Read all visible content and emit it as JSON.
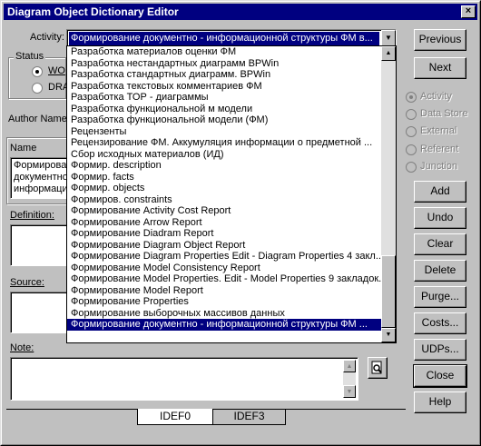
{
  "window": {
    "title": "Diagram Object Dictionary Editor",
    "close_glyph": "×"
  },
  "activity": {
    "label": "Activity:",
    "selected": "Формирование документно -  информационной структуры ФМ в...",
    "dropdown_items": [
      "Разработка материалов оценки ФМ",
      "Разработка нестандартных диаграмм  BPWin",
      "Разработка  стандартных диаграмм.  BPWin",
      "Разработка текстовых комментариев ФМ",
      "Разработка ТОР - диаграммы",
      "Разработка  функциональной м модели",
      "Разработка функциональной модели (ФМ)",
      "Рецензенты",
      "Рецензирование ФМ. Аккумуляция информации о предметной ...",
      "Сбор исходных материалов (ИД)",
      "Формир. description",
      "Формир. facts",
      "Формир. objects",
      "Формиров. constraints",
      "Формирование Activity Cost Report",
      "Формирование Arrow Report",
      "Формирование Diadram Report",
      "Формирование Diagram Object  Report",
      "Формирование Diagram Properties  Edit - Diagram Properties 4 закл...",
      "Формирование Model Consistency Report",
      "Формирование Model Properties. Edit - Model Properties 9 закладок.",
      "Формирование Model Report",
      "Формирование Properties",
      "Формирование выборочных массивов данных",
      "Формирование документно -  информационной структуры ФМ ..."
    ]
  },
  "status": {
    "label": "Status",
    "opt1": "WO",
    "opt2": "DRA"
  },
  "author_label": "Author Name",
  "name": {
    "label": "Name",
    "lines": [
      "Формирова",
      "документно",
      "информацио"
    ]
  },
  "definition_label": "Definition:",
  "source_label": "Source:",
  "note_label": "Note:",
  "object_types": [
    "Activity",
    "Data Store",
    "External",
    "Referent",
    "Junction"
  ],
  "buttons": {
    "previous": "Previous",
    "next": "Next",
    "add": "Add",
    "undo": "Undo",
    "clear": "Clear",
    "delete": "Delete",
    "purge": "Purge...",
    "costs": "Costs...",
    "udps": "UDPs...",
    "close": "Close",
    "help": "Help"
  },
  "tabs": [
    "IDEF0",
    "IDEF3"
  ]
}
